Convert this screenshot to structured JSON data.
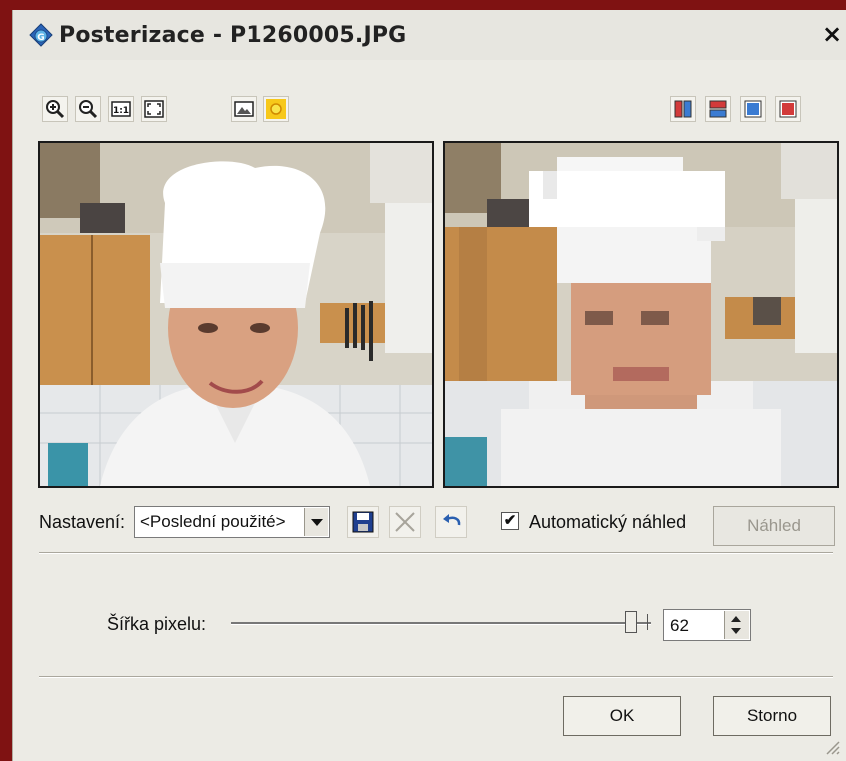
{
  "window": {
    "title": "Posterizace - P1260005.JPG",
    "close_label": "×"
  },
  "toolbar": {
    "left_icons": [
      "zoom-in-icon",
      "zoom-out-icon",
      "actual-size-icon",
      "fit-to-window-icon",
      "image-icon",
      "sun-icon"
    ],
    "one_to_one_label": "1:1",
    "right_icons": [
      "split-vertical-icon",
      "split-horizontal-icon",
      "view-original-icon",
      "view-result-icon"
    ]
  },
  "settings": {
    "label": "Nastavení:",
    "preset_value": "<Poslední použité>",
    "auto_preview_label": "Automatický náhled",
    "auto_preview_checked": true,
    "preview_button": "Náhled"
  },
  "pixel_width": {
    "label": "Šířka pixelu:",
    "value": "62"
  },
  "buttons": {
    "ok": "OK",
    "cancel": "Storno"
  },
  "colors": {
    "window_frame": "#7f1212",
    "dialog_bg": "#ecebe5",
    "accent_blue": "#2a5fb0"
  }
}
